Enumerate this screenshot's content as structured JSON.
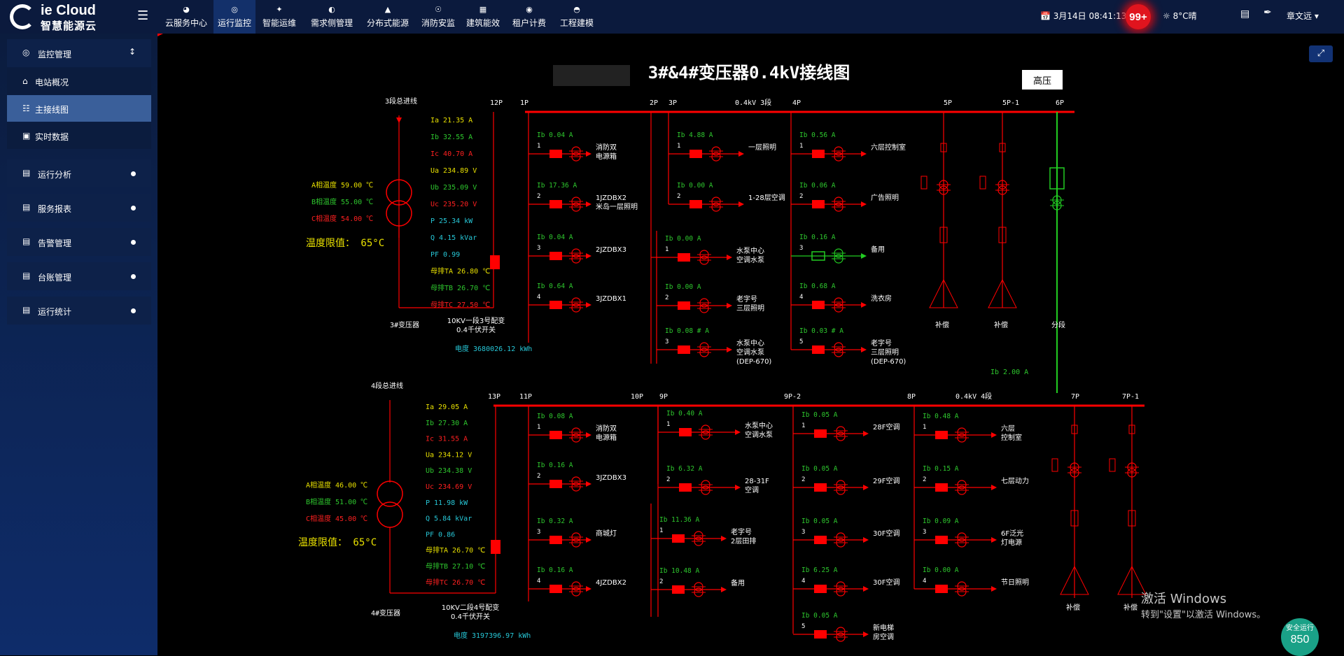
{
  "app": {
    "logo_text": "ie Cloud",
    "logo_sub": "智慧能源云"
  },
  "nav": [
    {
      "label": "云服务中心",
      "icon": "globe-icon"
    },
    {
      "label": "运行监控",
      "icon": "monitor-icon"
    },
    {
      "label": "智能运维",
      "icon": "maintenance-icon"
    },
    {
      "label": "需求侧管理",
      "icon": "demand-icon"
    },
    {
      "label": "分布式能源",
      "icon": "energy-icon"
    },
    {
      "label": "消防安监",
      "icon": "fire-icon"
    },
    {
      "label": "建筑能效",
      "icon": "building-icon"
    },
    {
      "label": "租户计费",
      "icon": "billing-icon"
    },
    {
      "label": "工程建模",
      "icon": "model-icon"
    }
  ],
  "header_right": {
    "date": "3月14日 08:41:13",
    "alarm_count": "99+",
    "weather": "8°C晴",
    "user": "章文远"
  },
  "sidebar": {
    "group": "监控管理",
    "subitems": [
      "电站概况",
      "主接线图",
      "实时数据"
    ],
    "items": [
      "运行分析",
      "服务报表",
      "告警管理",
      "台账管理",
      "运行统计"
    ]
  },
  "diagram": {
    "title": "3#&4#变压器0.4kV接线图",
    "hv_button": "高压",
    "upper": {
      "incoming_label": "3段总进线",
      "transformer_label": "3#变压器",
      "temp_limit": "温度限值： 65°C",
      "temps": [
        "A相温度  59.00 ℃",
        "B相温度  55.00 ℃",
        "C相温度  54.00 ℃"
      ],
      "readings": [
        "Ia  21.35  A",
        "Ib  32.55  A",
        "Ic  40.70  A",
        "Ua  234.89 V",
        "Ub  235.09 V",
        "Uc  235.20 V",
        "P   25.34  kW",
        "Q   4.15 kVar",
        "PF   0.99",
        "母排TA  26.80 ℃",
        "母排TB  26.70 ℃",
        "母排TC  27.50 ℃"
      ],
      "switch_label": "10KV一段3号配变\n0.4千伏开关",
      "energy": "电度   3680026.12  kWh",
      "bus_label": "0.4kV 3段",
      "panel_labels": [
        "12P",
        "1P",
        "2P",
        "3P",
        "4P",
        "5P",
        "5P-1",
        "6P"
      ],
      "p1": [
        {
          "ib": "Ib   0.04   A",
          "name": "消防双\n电源箱"
        },
        {
          "ib": "Ib   17.36  A",
          "name": "1JZDBX2\n米岛一层照明"
        },
        {
          "ib": "Ib   0.04   A",
          "name": "2JZDBX3"
        },
        {
          "ib": "Ib   0.64   A",
          "name": "3JZDBX1"
        }
      ],
      "p3": [
        {
          "ib": "Ib   4.88   A",
          "name": "一层照明"
        },
        {
          "ib": "Ib   0.00   A",
          "name": "1-28层空调"
        }
      ],
      "p3b": [
        {
          "ib": "Ib   0.00   A",
          "name": "水泵中心\n空调水泵"
        },
        {
          "ib": "Ib   0.00   A",
          "name": "老字号\n三层照明"
        },
        {
          "ib": "Ib  0.08 #  A",
          "name": "水泵中心\n空调水泵\n(DEP-670)"
        }
      ],
      "p4": [
        {
          "ib": "Ib   0.56   A",
          "name": "六层控制室"
        },
        {
          "ib": "Ib   0.06   A",
          "name": "广告照明"
        },
        {
          "ib": "Ib   0.16   A",
          "name": "备用"
        },
        {
          "ib": "Ib   0.68   A",
          "name": "洗衣房"
        },
        {
          "ib": "Ib  0.03 #  A",
          "name": "老字号\n三层照明\n(DEP-670)"
        }
      ],
      "comp": [
        "补偿",
        "补偿"
      ],
      "section_label": "分段",
      "section_ib": "Ib    2.00   A"
    },
    "lower": {
      "incoming_label": "4段总进线",
      "transformer_label": "4#变压器",
      "temp_limit": "温度限值： 65°C",
      "temps": [
        "A相温度  46.00 ℃",
        "B相温度  51.00 ℃",
        "C相温度  45.00 ℃"
      ],
      "readings": [
        "Ia  29.05  A",
        "Ib  27.30  A",
        "Ic  31.55  A",
        "Ua  234.12 V",
        "Ub  234.38 V",
        "Uc  234.69 V",
        "P   11.98  kW",
        "Q   5.84 kVar",
        "PF   0.86",
        "母排TA  26.70 ℃",
        "母排TB  27.10 ℃",
        "母排TC  26.70 ℃"
      ],
      "switch_label": "10KV二段4号配变\n0.4千伏开关",
      "energy": "电度   3197396.97  kWh",
      "bus_label": "0.4kV 4段",
      "panel_labels": [
        "13P",
        "11P",
        "10P",
        "9P",
        "9P-2",
        "8P",
        "7P",
        "7P-1"
      ],
      "p11": [
        {
          "ib": "Ib   0.08   A",
          "name": "消防双\n电源箱"
        },
        {
          "ib": "Ib   0.16   A",
          "name": "3JZDBX3"
        },
        {
          "ib": "Ib   0.32   A",
          "name": "商城灯"
        },
        {
          "ib": "Ib   0.16   A",
          "name": "4JZDBX2"
        }
      ],
      "p9": [
        {
          "ib": "Ib   0.40   A",
          "name": "水泵中心\n空调水泵"
        },
        {
          "ib": "Ib   6.32   A",
          "name": "28-31F\n空调"
        }
      ],
      "p9b": [
        {
          "ib": "Ib   11.36  A",
          "name": "老字号\n2层田排"
        },
        {
          "ib": "Ib   10.48  A",
          "name": "备用"
        }
      ],
      "p92": [
        {
          "ib": "Ib   0.05   A",
          "name": "28F空调"
        },
        {
          "ib": "Ib   0.05   A",
          "name": "29F空调"
        },
        {
          "ib": "Ib   0.05   A",
          "name": "30F空调"
        },
        {
          "ib": "Ib   6.25   A",
          "name": "30F空调"
        },
        {
          "ib": "Ib   0.05   A",
          "name": "新电梯\n房空调"
        }
      ],
      "p8": [
        {
          "ib": "Ib   0.48   A",
          "name": "六层\n控制室"
        },
        {
          "ib": "Ib   0.15   A",
          "name": "七层动力"
        },
        {
          "ib": "Ib   0.09   A",
          "name": "6F泛光\n灯电源"
        },
        {
          "ib": "Ib   0.00   A",
          "name": "节日照明"
        }
      ],
      "comp": [
        "补偿",
        "补偿"
      ]
    }
  },
  "watermark": {
    "line1": "激活 Windows",
    "line2": "转到\"设置\"以激活 Windows。"
  },
  "safe_badge": {
    "label": "安全运行",
    "days": "850"
  },
  "colors": {
    "bus": "#ff0000",
    "value_yellow": "#e8e000",
    "value_green": "#2ec82e",
    "value_red": "#ff2020",
    "cyan": "#27c8d8",
    "section_green": "#22cc22"
  }
}
